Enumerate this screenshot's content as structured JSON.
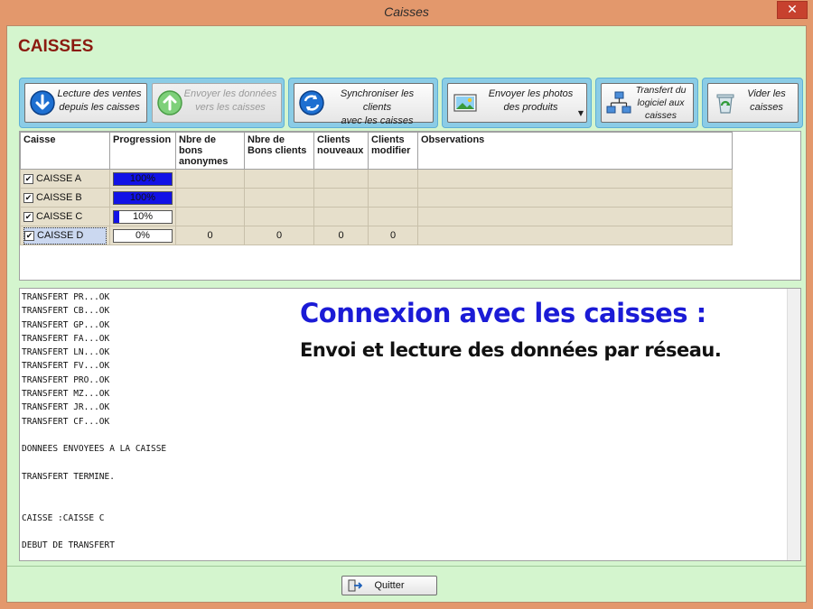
{
  "window": {
    "title": "Caisses",
    "close_glyph": "✕"
  },
  "app": {
    "heading": "CAISSES"
  },
  "toolbar": {
    "buttons": [
      {
        "label": "Lecture des ventes\ndepuis les caisses",
        "icon": "down-arrow-icon"
      },
      {
        "label": "Envoyer les données\nvers les caisses",
        "icon": "up-arrow-icon",
        "disabled": true
      },
      {
        "label": "Synchroniser les clients\navec les caisses",
        "icon": "sync-icon"
      },
      {
        "label": "Envoyer les photos\ndes produits",
        "icon": "photo-icon",
        "dropdown_glyph": "▼"
      },
      {
        "label": "Transfert du\nlogiciel aux\ncaisses",
        "icon": "network-icon"
      },
      {
        "label": "Vider les\ncaisses",
        "icon": "recycle-icon"
      }
    ]
  },
  "grid": {
    "columns": [
      "Caisse",
      "Progression",
      "Nbre de bons anonymes",
      "Nbre de Bons clients",
      "Clients nouveaux",
      "Clients modifier",
      "Observations"
    ],
    "rows": [
      {
        "name": "CAISSE A",
        "checked": true,
        "progress": 100,
        "progress_text": "100%",
        "bons_anonymes": "",
        "bons_clients": "",
        "clients_nouveaux": "",
        "clients_modifier": "",
        "observations": ""
      },
      {
        "name": "CAISSE B",
        "checked": true,
        "progress": 100,
        "progress_text": "100%",
        "bons_anonymes": "",
        "bons_clients": "",
        "clients_nouveaux": "",
        "clients_modifier": "",
        "observations": ""
      },
      {
        "name": "CAISSE C",
        "checked": true,
        "progress": 10,
        "progress_text": "10%",
        "bons_anonymes": "",
        "bons_clients": "",
        "clients_nouveaux": "",
        "clients_modifier": "",
        "observations": ""
      },
      {
        "name": "CAISSE D",
        "checked": true,
        "progress": 0,
        "progress_text": "0%",
        "bons_anonymes": "0",
        "bons_clients": "0",
        "clients_nouveaux": "0",
        "clients_modifier": "0",
        "observations": "",
        "selected": true
      }
    ]
  },
  "log": {
    "lines": [
      "TRANSFERT PR...OK",
      "TRANSFERT CB...OK",
      "TRANSFERT GP...OK",
      "TRANSFERT FA...OK",
      "TRANSFERT LN...OK",
      "TRANSFERT FV...OK",
      "TRANSFERT PRO..OK",
      "TRANSFERT MZ...OK",
      "TRANSFERT JR...OK",
      "TRANSFERT CF...OK",
      "",
      "DONNEES ENVOYEES A LA CAISSE",
      "",
      "TRANSFERT TERMINE.",
      "",
      "",
      "CAISSE :CAISSE C",
      "",
      "DEBUT DE TRANSFERT"
    ]
  },
  "overlay": {
    "headline": "Connexion avec les caisses :",
    "subline": "Envoi et lecture des données par réseau."
  },
  "footer": {
    "quit_label": "Quitter",
    "quit_icon": "exit-door-icon"
  },
  "colors": {
    "accent": "#1212e6",
    "heading": "#8b1a10",
    "background": "#d4f5ce",
    "frame": "#e3986c"
  }
}
